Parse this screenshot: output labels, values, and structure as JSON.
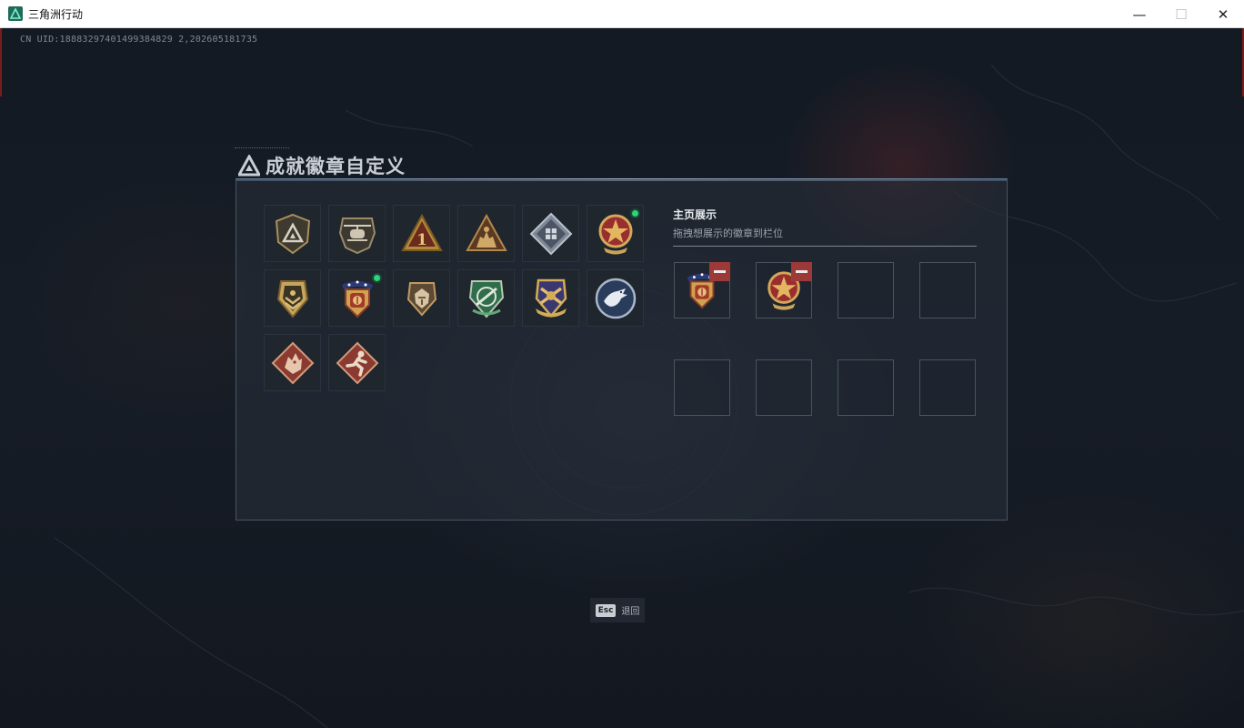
{
  "window": {
    "title": "三角洲行动",
    "minimize": "—",
    "maximize": "☐",
    "close": "✕"
  },
  "uid_text": "CN UID:18883297401499384829 2,202605181735",
  "panel": {
    "title": "成就徽章自定义",
    "badges": [
      {
        "icon": "delta-triangle-badge-icon",
        "new": false
      },
      {
        "icon": "helicopter-badge-icon",
        "new": false
      },
      {
        "icon": "number-one-triangle-badge-icon",
        "new": false
      },
      {
        "icon": "soldiers-triangle-badge-icon",
        "new": false
      },
      {
        "icon": "crate-diamond-badge-icon",
        "new": false
      },
      {
        "icon": "red-star-medal-badge-icon",
        "new": true
      },
      {
        "icon": "gold-chevron-shield-badge-icon",
        "new": false
      },
      {
        "icon": "starred-eagle-medal-badge-icon",
        "new": true
      },
      {
        "icon": "lion-shield-badge-icon",
        "new": false
      },
      {
        "icon": "green-rifle-shield-badge-icon",
        "new": false
      },
      {
        "icon": "purple-weapon-shield-badge-icon",
        "new": false
      },
      {
        "icon": "eagle-round-badge-icon",
        "new": false
      },
      {
        "icon": "red-dragon-diamond-badge-icon",
        "new": false
      },
      {
        "icon": "red-runner-diamond-badge-icon",
        "new": false
      }
    ],
    "showcase": {
      "title": "主页展示",
      "subtitle": "拖拽想展示的徽章到栏位",
      "slots": [
        {
          "icon": "starred-eagle-medal-badge-icon",
          "filled": true
        },
        {
          "icon": "red-star-medal-badge-icon",
          "filled": true
        },
        {
          "filled": false
        },
        {
          "filled": false
        },
        {
          "filled": false
        },
        {
          "filled": false
        },
        {
          "filled": false
        },
        {
          "filled": false
        }
      ]
    }
  },
  "esc_hint": {
    "key": "Esc",
    "label": "退回"
  },
  "colors": {
    "accent_new": "#2bd47a",
    "remove_button": "#9c3a3a",
    "gold": "#c9a55a"
  }
}
